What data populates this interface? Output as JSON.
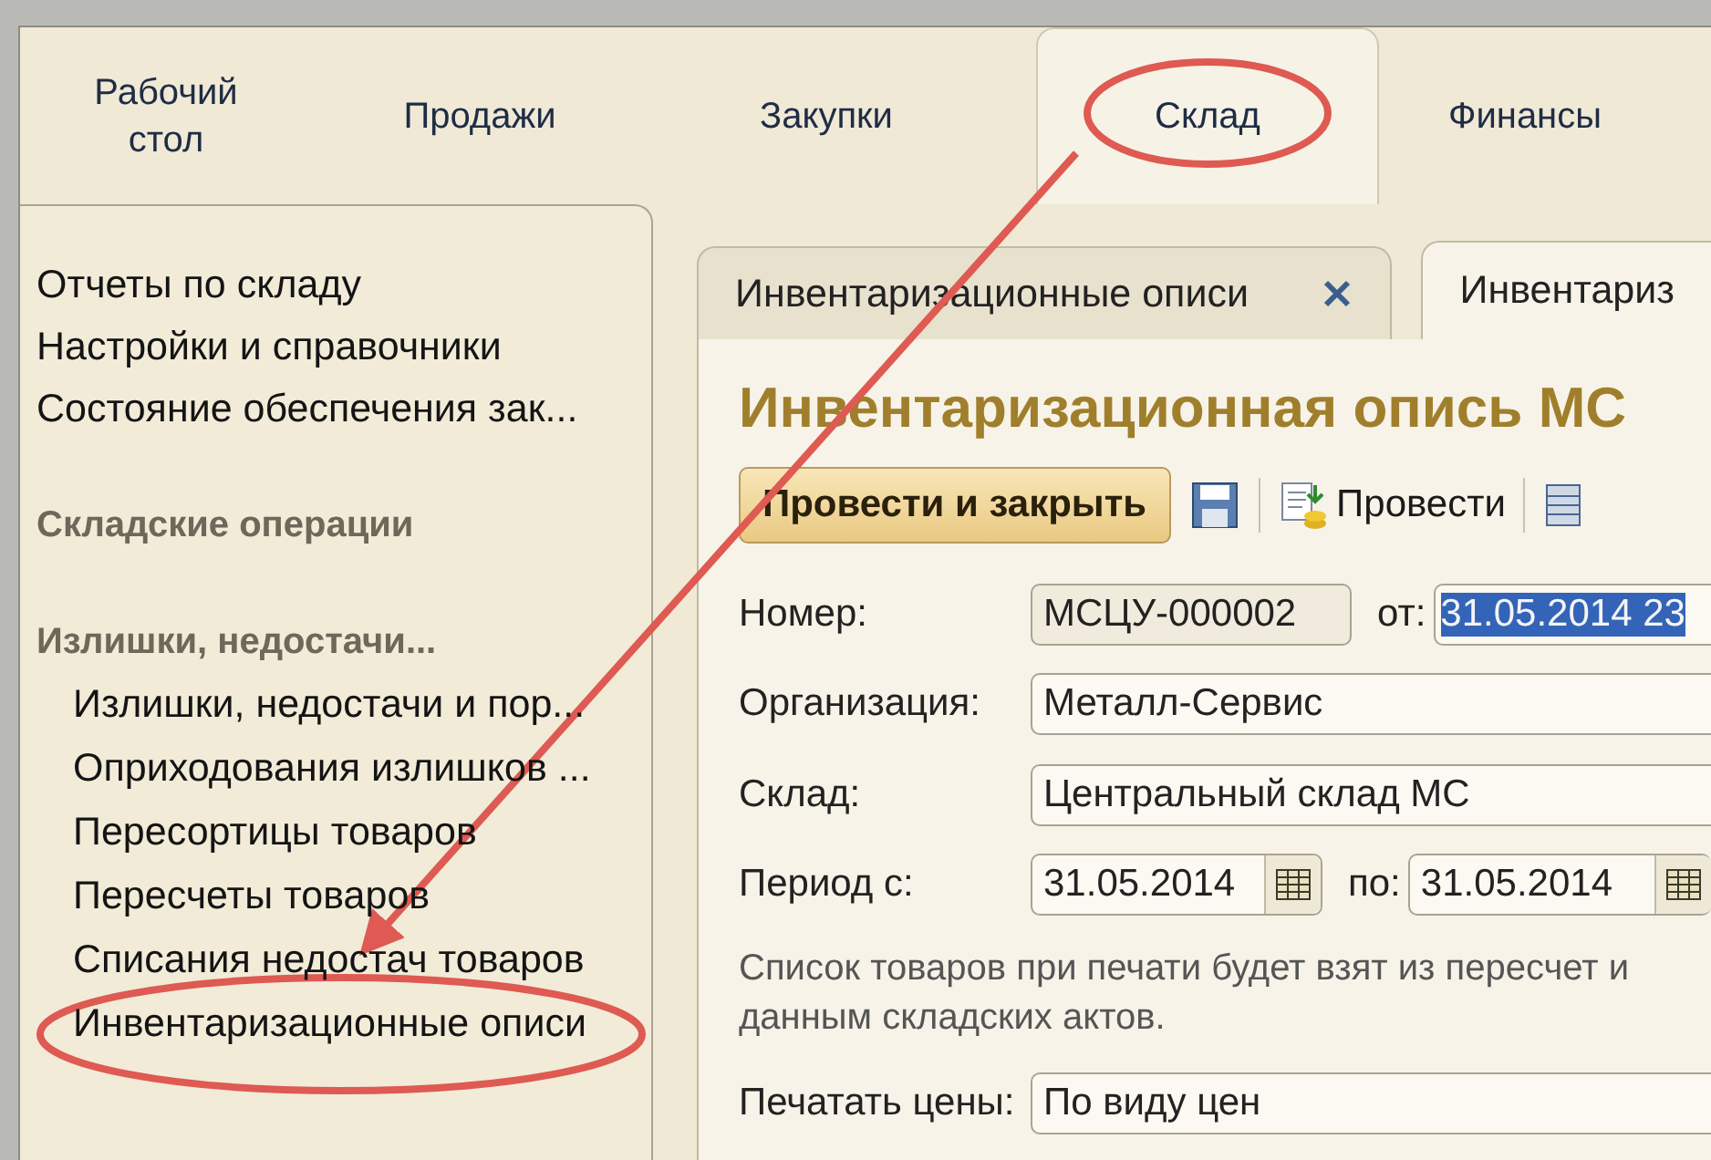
{
  "sections": [
    {
      "label": "Рабочий стол",
      "selected": false
    },
    {
      "label": "Продажи",
      "selected": false
    },
    {
      "label": "Закупки",
      "selected": false
    },
    {
      "label": "Склад",
      "selected": true
    },
    {
      "label": "Финансы",
      "selected": false
    }
  ],
  "nav_panel": {
    "items": [
      {
        "kind": "link",
        "label": "Отчеты по складу"
      },
      {
        "kind": "link",
        "label": "Настройки и справочники"
      },
      {
        "kind": "link",
        "label": "Состояние обеспечения зак..."
      },
      {
        "kind": "header",
        "label": "Складские операции"
      },
      {
        "kind": "header",
        "label": "Излишки, недостачи..."
      },
      {
        "kind": "sublink",
        "label": "Излишки, недостачи и пор..."
      },
      {
        "kind": "sublink",
        "label": "Оприходования излишков ..."
      },
      {
        "kind": "sublink",
        "label": "Пересортицы товаров"
      },
      {
        "kind": "sublink",
        "label": "Пересчеты товаров"
      },
      {
        "kind": "sublink",
        "label": "Списания недостач товаров"
      },
      {
        "kind": "sublink",
        "label": "Инвентаризационные описи"
      }
    ]
  },
  "document_tabs": [
    {
      "label": "Инвентаризационные описи",
      "selected": false,
      "closable": true
    },
    {
      "label": "Инвентариз",
      "selected": true,
      "closable": false
    }
  ],
  "form": {
    "title": "Инвентаризационная опись МС",
    "toolbar": [
      {
        "kind": "primary",
        "label": "Провести и закрыть"
      },
      {
        "kind": "save"
      },
      {
        "kind": "post",
        "label": "Провести"
      },
      {
        "kind": "list"
      }
    ],
    "rows": [
      {
        "kind": "number",
        "label": "Номер:",
        "value": "МСЦУ-000002",
        "date_label": "от:",
        "date_value": "31.05.2014 23",
        "date_selected": true
      },
      {
        "kind": "text",
        "label": "Организация:",
        "value": "Металл-Сервис"
      },
      {
        "kind": "text",
        "label": "Склад:",
        "value": "Центральный склад МС"
      },
      {
        "kind": "period",
        "label": "Период с:",
        "value": "31.05.2014",
        "to_label": "по:",
        "to_value": "31.05.2014"
      },
      {
        "kind": "note",
        "text": "Список товаров при печати будет взят из пересчет и данным складских актов."
      },
      {
        "kind": "text",
        "label": "Печатать цены:",
        "value": "По виду цен"
      }
    ]
  }
}
